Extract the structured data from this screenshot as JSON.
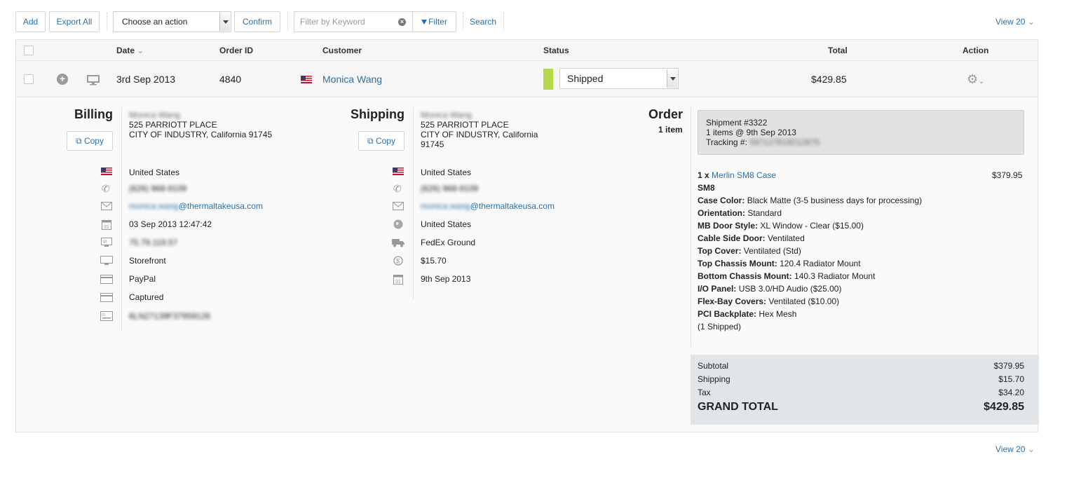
{
  "toolbar": {
    "add": "Add",
    "export_all": "Export All",
    "action_select": "Choose an action",
    "confirm": "Confirm",
    "filter_placeholder": "Filter by Keyword",
    "filter": "Filter",
    "search": "Search",
    "view": "View 20"
  },
  "table": {
    "headers": {
      "date": "Date",
      "order_id": "Order ID",
      "customer": "Customer",
      "status": "Status",
      "total": "Total",
      "action": "Action"
    },
    "row": {
      "date": "3rd Sep 2013",
      "order_id": "4840",
      "customer": "Monica Wang",
      "status": "Shipped",
      "status_color": "#b5d74a",
      "total": "$429.85"
    }
  },
  "billing": {
    "title": "Billing",
    "copy": "Copy",
    "name": "Monica Wang",
    "address1": "525 PARRIOTT PLACE",
    "address2": "CITY OF INDUSTRY, California 91745",
    "country": "United States",
    "phone": "(626) 968-9109",
    "email_user": "monica.wang",
    "email_domain": "@thermaltakeusa.com",
    "date": "03 Sep 2013 12:47:42",
    "ip": "75.79.119.57",
    "source": "Storefront",
    "payment": "PayPal",
    "payment_status": "Captured",
    "transaction_id": "6LN27139F37959126"
  },
  "shipping": {
    "title": "Shipping",
    "copy": "Copy",
    "name": "Monica Wang",
    "address1": "525 PARRIOTT PLACE",
    "address2": "CITY OF INDUSTRY, California",
    "address3": "91745",
    "country": "United States",
    "phone": "(626) 968-9109",
    "email_user": "monica.wang",
    "email_domain": "@thermaltakeusa.com",
    "region": "United States",
    "method": "FedEx Ground",
    "cost": "$15.70",
    "date": "9th Sep 2013"
  },
  "order": {
    "title": "Order",
    "count": "1 item",
    "shipment": {
      "link": "Shipment #3322",
      "items": "1 items @ 9th Sep 2013",
      "tracking_label": "Tracking #:",
      "tracking": "587127819212875"
    },
    "item": {
      "qty": "1 x",
      "name": "Merlin SM8 Case",
      "price": "$379.95",
      "sku": "SM8",
      "options": [
        {
          "label": "Case Color:",
          "value": "Black Matte (3-5 business days for processing)"
        },
        {
          "label": "Orientation:",
          "value": "Standard"
        },
        {
          "label": "MB Door Style:",
          "value": "XL Window - Clear ($15.00)"
        },
        {
          "label": "Cable Side Door:",
          "value": "Ventilated"
        },
        {
          "label": "Top Cover:",
          "value": "Ventilated (Std)"
        },
        {
          "label": "Top Chassis Mount:",
          "value": "120.4 Radiator Mount"
        },
        {
          "label": "Bottom Chassis Mount:",
          "value": "140.3 Radiator Mount"
        },
        {
          "label": "I/O Panel:",
          "value": "USB 3.0/HD Audio ($25.00)"
        },
        {
          "label": "Flex-Bay Covers:",
          "value": "Ventilated ($10.00)"
        },
        {
          "label": "PCI Backplate:",
          "value": "Hex Mesh"
        }
      ],
      "shipped": "(1 Shipped)"
    },
    "totals": {
      "subtotal_label": "Subtotal",
      "subtotal": "$379.95",
      "shipping_label": "Shipping",
      "shipping": "$15.70",
      "tax_label": "Tax",
      "tax": "$34.20",
      "grand_label": "GRAND TOTAL",
      "grand": "$429.85"
    }
  },
  "footer": {
    "view": "View 20"
  }
}
